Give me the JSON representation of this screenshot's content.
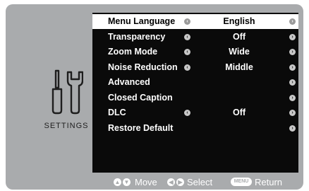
{
  "side": {
    "icon": "tools-icon",
    "label": "SETTINGS"
  },
  "menu": {
    "items": [
      {
        "label": "Menu Language",
        "value": "English",
        "left_arrow": true,
        "right_arrow": true,
        "selected": true
      },
      {
        "label": "Transparency",
        "value": "Off",
        "left_arrow": true,
        "right_arrow": true,
        "selected": false
      },
      {
        "label": "Zoom Mode",
        "value": "Wide",
        "left_arrow": true,
        "right_arrow": true,
        "selected": false
      },
      {
        "label": "Noise Reduction",
        "value": "Middle",
        "left_arrow": true,
        "right_arrow": true,
        "selected": false
      },
      {
        "label": "Advanced",
        "value": "",
        "left_arrow": false,
        "right_arrow": true,
        "selected": false
      },
      {
        "label": "Closed Caption",
        "value": "",
        "left_arrow": false,
        "right_arrow": true,
        "selected": false
      },
      {
        "label": "DLC",
        "value": "Off",
        "left_arrow": true,
        "right_arrow": true,
        "selected": false
      },
      {
        "label": "Restore Default",
        "value": "",
        "left_arrow": false,
        "right_arrow": true,
        "selected": false
      }
    ],
    "arrow_left_glyph": "‹",
    "arrow_right_glyph": "›"
  },
  "footer": {
    "move_label": "Move",
    "select_label": "Select",
    "menu_key": "MENU",
    "return_label": "Return"
  },
  "colors": {
    "panel": "#a9abad",
    "menu_bg": "#0a0a0a",
    "highlight": "#ffffff"
  }
}
